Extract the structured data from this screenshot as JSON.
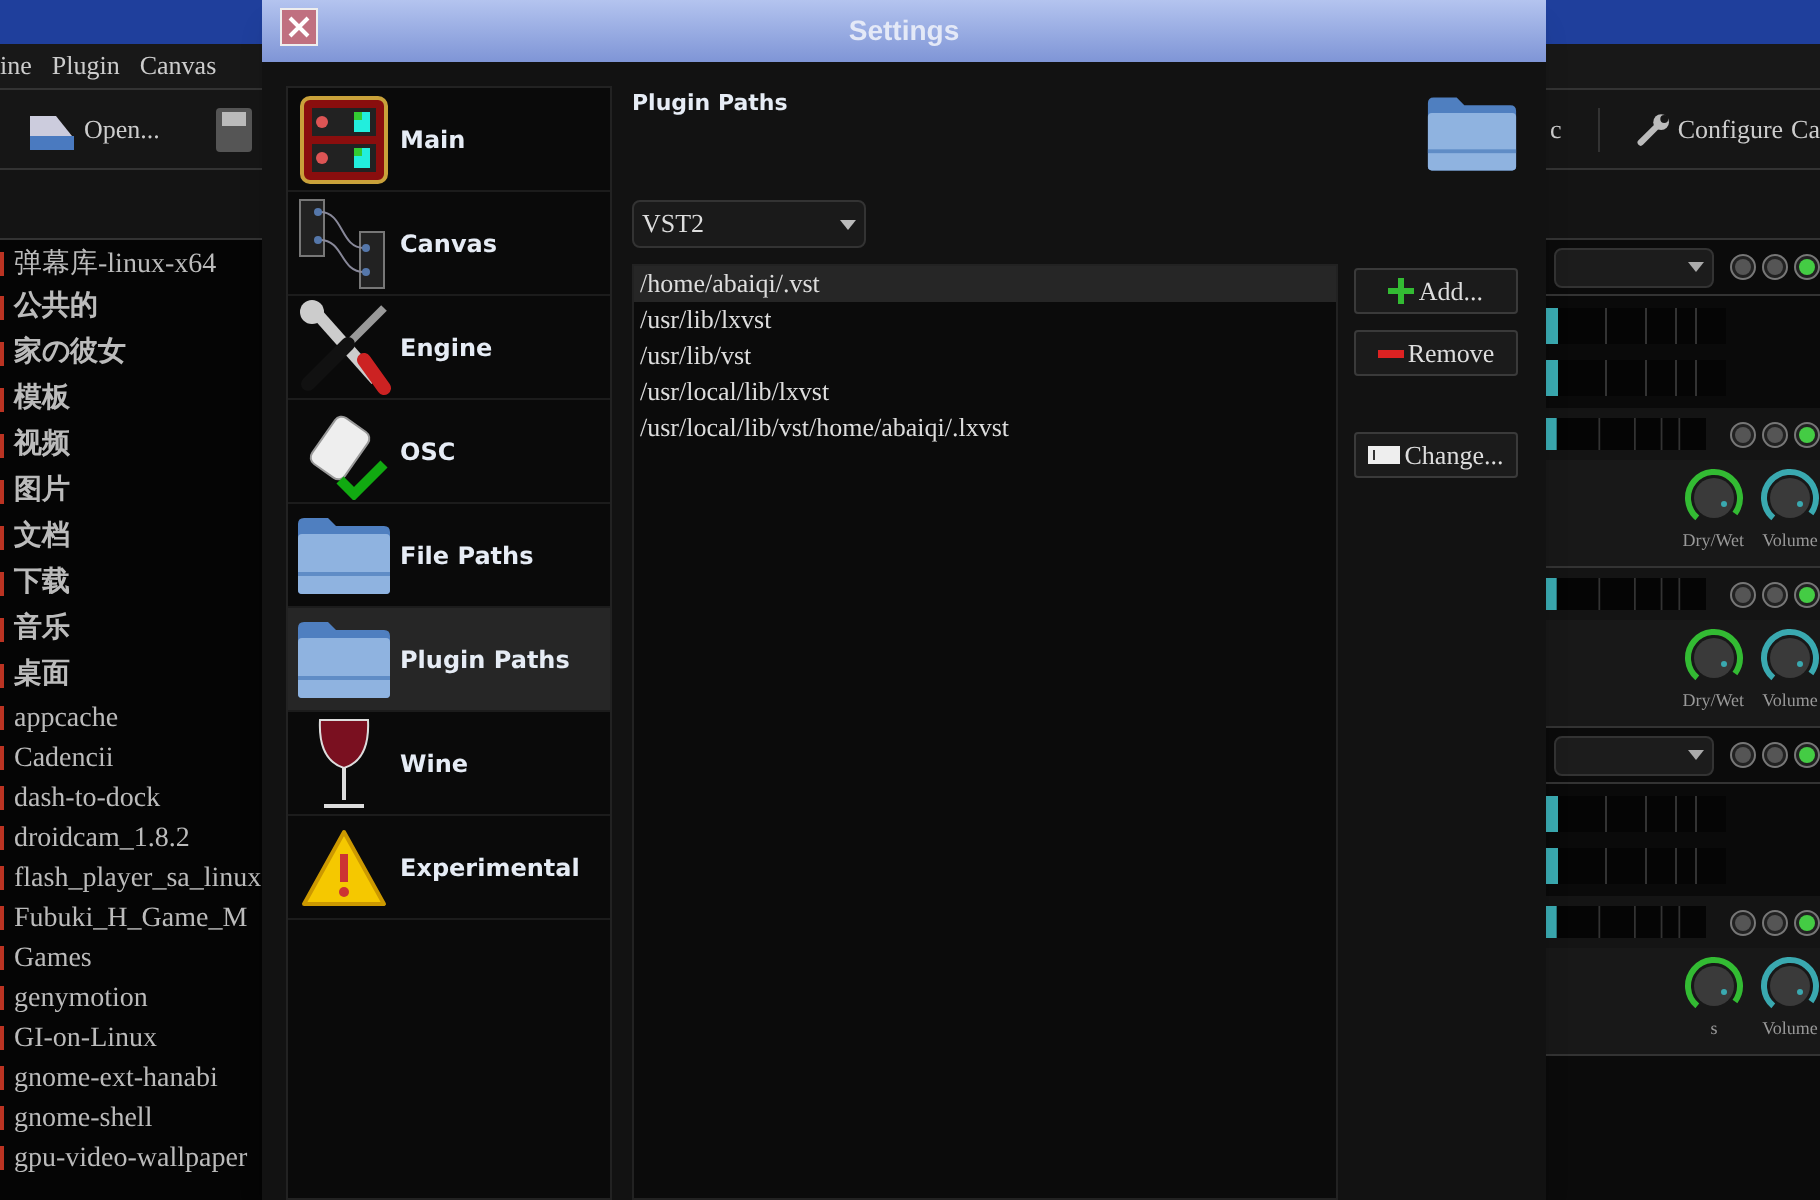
{
  "background_app": {
    "menu": [
      "ine",
      "Plugin",
      "Canvas"
    ],
    "toolbar_left": [
      "Open..."
    ],
    "toolbar_right": [
      "c",
      "Configure",
      "Ca"
    ],
    "files": [
      {
        "name": "弹幕库-linux-x64",
        "bold": false
      },
      {
        "name": "公共的",
        "bold": true
      },
      {
        "name": "家の彼女",
        "bold": true
      },
      {
        "name": "模板",
        "bold": true
      },
      {
        "name": "视频",
        "bold": true
      },
      {
        "name": "图片",
        "bold": true
      },
      {
        "name": "文档",
        "bold": true
      },
      {
        "name": "下载",
        "bold": true
      },
      {
        "name": "音乐",
        "bold": true
      },
      {
        "name": "桌面",
        "bold": true
      },
      {
        "name": "appcache",
        "bold": false
      },
      {
        "name": "Cadencii",
        "bold": false
      },
      {
        "name": "dash-to-dock",
        "bold": false
      },
      {
        "name": "droidcam_1.8.2",
        "bold": false
      },
      {
        "name": "flash_player_sa_linux",
        "bold": false
      },
      {
        "name": "Fubuki_H_Game_M",
        "bold": false
      },
      {
        "name": "Games",
        "bold": false
      },
      {
        "name": "genymotion",
        "bold": false
      },
      {
        "name": "GI-on-Linux",
        "bold": false
      },
      {
        "name": "gnome-ext-hanabi",
        "bold": false
      },
      {
        "name": "gnome-shell",
        "bold": false
      },
      {
        "name": "gpu-video-wallpaper",
        "bold": false
      }
    ],
    "rack": [
      {
        "kind": "combo"
      },
      {
        "kind": "meters"
      },
      {
        "kind": "meter"
      },
      {
        "kind": "knobs",
        "labels": [
          "Dry/Wet",
          "Volume"
        ]
      },
      {
        "kind": "meter"
      },
      {
        "kind": "knobs",
        "labels": [
          "Dry/Wet",
          "Volume"
        ]
      },
      {
        "kind": "combo"
      },
      {
        "kind": "meters"
      },
      {
        "kind": "meter"
      },
      {
        "kind": "knobs",
        "labels": [
          "s",
          "Volume"
        ]
      }
    ]
  },
  "dialog": {
    "title": "Settings",
    "sidebar": [
      {
        "label": "Main",
        "selected": false
      },
      {
        "label": "Canvas",
        "selected": false
      },
      {
        "label": "Engine",
        "selected": false
      },
      {
        "label": "OSC",
        "selected": false
      },
      {
        "label": "File Paths",
        "selected": false
      },
      {
        "label": "Plugin Paths",
        "selected": true
      },
      {
        "label": "Wine",
        "selected": false
      },
      {
        "label": "Experimental",
        "selected": false
      }
    ],
    "panel_title": "Plugin Paths",
    "plugin_type": "VST2",
    "paths": [
      {
        "text": "/home/abaiqi/.vst",
        "selected": true
      },
      {
        "text": "/usr/lib/lxvst",
        "selected": false
      },
      {
        "text": "/usr/lib/vst",
        "selected": false
      },
      {
        "text": "/usr/local/lib/lxvst",
        "selected": false
      },
      {
        "text": "/usr/local/lib/vst/home/abaiqi/.lxvst",
        "selected": false
      }
    ],
    "buttons": [
      {
        "kind": "add",
        "label": "Add..."
      },
      {
        "kind": "remove",
        "label": "Remove"
      },
      {
        "kind": "change",
        "label": "Change..."
      }
    ]
  }
}
